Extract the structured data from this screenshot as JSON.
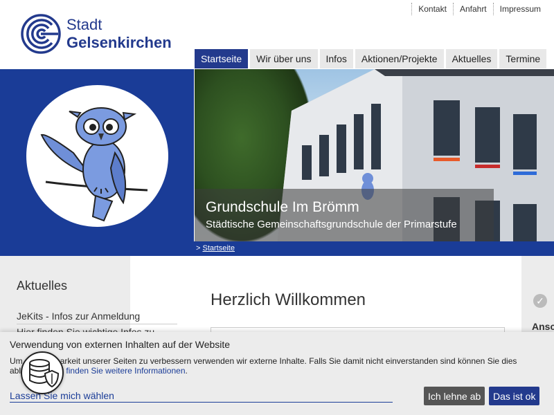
{
  "toplinks": [
    "Kontakt",
    "Anfahrt",
    "Impressum"
  ],
  "logo": {
    "line1": "Stadt",
    "line2": "Gelsenkirchen",
    "icon": "city-logo-icon"
  },
  "nav": {
    "tabs": [
      "Startseite",
      "Wir über uns",
      "Infos",
      "Aktionen/Projekte",
      "Aktuelles",
      "Termine"
    ],
    "active": "Startseite"
  },
  "hero": {
    "title": "Grundschule Im Brömm",
    "subtitle": "Städtische Gemeinschaftsgrundschule der Primarstufe",
    "mascot_icon": "owl-icon"
  },
  "breadcrumb": {
    "prefix": ">",
    "current": "Startseite"
  },
  "sidebar": {
    "heading": "Aktuelles",
    "items": [
      "JeKits - Infos zur Anmeldung",
      "Hier finden Sie wichtige Infos zu"
    ]
  },
  "main": {
    "title": "Herzlich Willkommen"
  },
  "right": {
    "label": "Ansc"
  },
  "cookie": {
    "title": "Verwendung von externen Inhalten auf der Website",
    "text_part1": "Um die Nutzbarkeit unserer Seiten zu verbessern verwenden wir externe Inhalte. Falls Sie damit nicht einverstanden sind können Sie dies ablehnen. ",
    "link": "Hier finden Sie weitere Informationen",
    "text_part2": ".",
    "choose": "Lassen Sie mich wählen",
    "decline": "Ich lehne ab",
    "accept": "Das ist ok"
  },
  "colors": {
    "brand_blue": "#233a8d",
    "hero_blue": "#1a3c97",
    "decline_gray": "#555555"
  }
}
